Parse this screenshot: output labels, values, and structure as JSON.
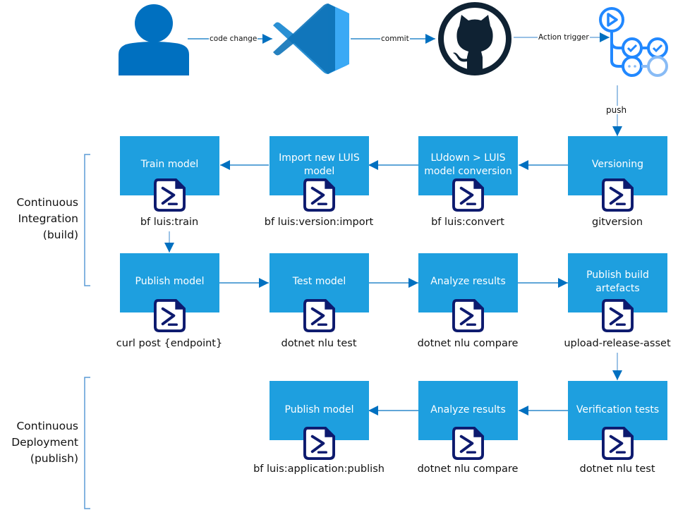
{
  "top_flow": {
    "nodes": [
      {
        "name": "developer",
        "icon": "person-icon"
      },
      {
        "name": "vscode",
        "icon": "vscode-icon"
      },
      {
        "name": "github",
        "icon": "github-icon"
      },
      {
        "name": "github-actions",
        "icon": "github-actions-icon"
      }
    ],
    "edges": [
      {
        "label": "code change"
      },
      {
        "label": "commit"
      },
      {
        "label": "Action trigger"
      },
      {
        "label": "push"
      }
    ]
  },
  "sections": {
    "ci": {
      "label_lines": [
        "Continuous",
        "Integration",
        "(build)"
      ]
    },
    "cd": {
      "label_lines": [
        "Continuous",
        "Deployment",
        "(publish)"
      ]
    }
  },
  "ci_row1": [
    {
      "title": "Train model",
      "command": "bf luis:train",
      "icon": "powershell-script-icon"
    },
    {
      "title": "Import new LUIS model",
      "command": "bf luis:version:import",
      "icon": "powershell-script-icon"
    },
    {
      "title": "LUdown > LUIS model conversion",
      "command": "bf luis:convert",
      "icon": "powershell-script-icon"
    },
    {
      "title": "Versioning",
      "command": "gitversion",
      "icon": "powershell-script-icon"
    }
  ],
  "ci_row2": [
    {
      "title": "Publish model",
      "command": "curl post {endpoint}",
      "icon": "powershell-script-icon"
    },
    {
      "title": "Test model",
      "command": "dotnet nlu test",
      "icon": "powershell-script-icon"
    },
    {
      "title": "Analyze results",
      "command": "dotnet nlu compare",
      "icon": "powershell-script-icon"
    },
    {
      "title": "Publish build artefacts",
      "command": "upload-release-asset",
      "icon": "powershell-script-icon"
    }
  ],
  "cd_row": [
    {
      "title": "Publish model",
      "command": "bf luis:application:publish",
      "icon": "powershell-script-icon"
    },
    {
      "title": "Analyze results",
      "command": "dotnet nlu compare",
      "icon": "powershell-script-icon"
    },
    {
      "title": "Verification tests",
      "command": "dotnet nlu test",
      "icon": "powershell-script-icon"
    }
  ],
  "colors": {
    "box_fill": "#1e9fdf",
    "arrow": "#0070c0",
    "bracket": "#5b9bd5",
    "person": "#0070c0",
    "github": "#0f2233",
    "actions": "#2188ff",
    "powershell_outline": "#0d1a6e"
  }
}
